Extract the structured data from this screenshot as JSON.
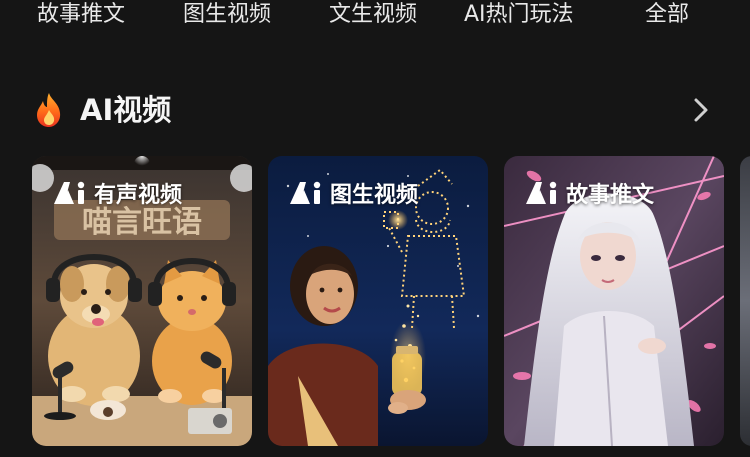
{
  "tabs": [
    {
      "label": "故事推文"
    },
    {
      "label": "图生视频"
    },
    {
      "label": "文生视频"
    },
    {
      "label": "AI热门玩法"
    },
    {
      "label": "全部"
    }
  ],
  "section": {
    "title": "AI视频",
    "title_icon": "flame-icon",
    "more_icon": "chevron-right-icon"
  },
  "cards": [
    {
      "label": "有声视频",
      "sign_text": "喵言旺语",
      "icon": "ai-logo-icon"
    },
    {
      "label": "图生视频",
      "icon": "ai-logo-icon"
    },
    {
      "label": "故事推文",
      "icon": "ai-logo-icon"
    }
  ],
  "colors": {
    "background": "#151515",
    "text": "#f2f2f2",
    "flame_orange": "#ff7a1a",
    "flame_red": "#e8321f"
  }
}
